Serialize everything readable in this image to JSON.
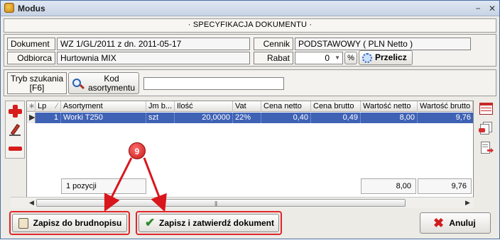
{
  "window": {
    "title": "Modus",
    "minimize_glyph": "−",
    "maximize_glyph": "□",
    "close_glyph": "✕"
  },
  "section_title": "· SPECYFIKACJA DOKUMENTU ·",
  "document": {
    "dokument_label": "Dokument",
    "dokument_value": "WZ 1/GL/2011 z dn. 2011-05-17",
    "odbiorca_label": "Odbiorca",
    "odbiorca_value": "Hurtownia MIX",
    "cennik_label": "Cennik",
    "cennik_value": "PODSTAWOWY ( PLN Netto )",
    "rabat_label": "Rabat",
    "rabat_value": "0",
    "percent_label": "%",
    "przelicz_label": "Przelicz"
  },
  "search": {
    "tryb_label": "Tryb szukania [F6]",
    "kod_label": "Kod asortymentu",
    "input_value": ""
  },
  "table": {
    "columns": [
      "Lp",
      "Asortyment",
      "Jm b...",
      "Ilość",
      "Vat",
      "Cena netto",
      "Cena brutto",
      "Wartość netto",
      "Wartość brutto"
    ],
    "rows": [
      {
        "lp": "1",
        "asortyment": "Worki T250",
        "jm": "szt",
        "ilosc": "20,0000",
        "vat": "22%",
        "cena_netto": "0,40",
        "cena_brutto": "0,49",
        "wartosc_netto": "8,00",
        "wartosc_brutto": "9,76"
      }
    ],
    "footer_count": "1 pozycji",
    "footer_netto": "8,00",
    "footer_brutto": "9,76"
  },
  "annotation_badge": "9",
  "buttons": {
    "brudnopis": "Zapisz do brudnopisu",
    "zatwierdz": "Zapisz i zatwierdź dokument",
    "anuluj": "Anuluj"
  },
  "colors": {
    "selection": "#3f62b5",
    "highlight": "#e0262b"
  }
}
